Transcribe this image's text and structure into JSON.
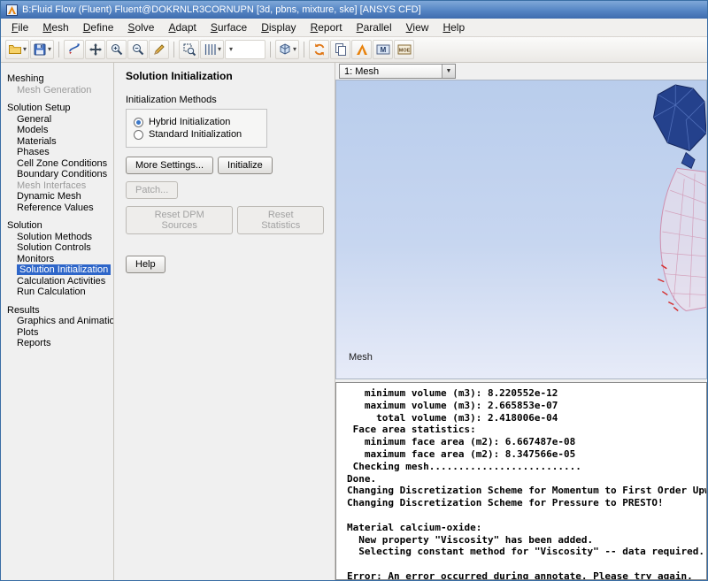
{
  "window": {
    "title": "B:Fluid Flow (Fluent) Fluent@DOKRNLR3CORNUPN [3d, pbns, mixture, ske] [ANSYS CFD]"
  },
  "menubar": {
    "items": [
      "File",
      "Mesh",
      "Define",
      "Solve",
      "Adapt",
      "Surface",
      "Display",
      "Report",
      "Parallel",
      "View",
      "Help"
    ]
  },
  "toolbar": {
    "buttons": [
      {
        "name": "open-file-button",
        "icon": "folder-icon",
        "dropdown": true
      },
      {
        "name": "save-button",
        "icon": "floppy-icon",
        "dropdown": true
      },
      {
        "separator": true
      },
      {
        "name": "rotate-view-button",
        "icon": "rotate-icon"
      },
      {
        "name": "pan-button",
        "icon": "pan-icon"
      },
      {
        "name": "zoom-in-button",
        "icon": "zoom-in-icon"
      },
      {
        "name": "zoom-out-button",
        "icon": "zoom-out-icon"
      },
      {
        "name": "probe-button",
        "icon": "pencil-icon"
      },
      {
        "separator": true
      },
      {
        "name": "fit-to-window-button",
        "icon": "zoom-fit-icon"
      },
      {
        "name": "wireframe-display-button",
        "icon": "grid-icon",
        "dropdown": true
      },
      {
        "name": "surface-combobox",
        "icon": "combo-icon",
        "dropdown": true,
        "combo": true
      },
      {
        "separator": true
      },
      {
        "name": "orientation-cube-button",
        "icon": "cube-icon",
        "dropdown": true
      },
      {
        "separator": true
      },
      {
        "name": "refresh-workbench-button",
        "icon": "refresh-icon"
      },
      {
        "name": "copy-screenshot-button",
        "icon": "copy-icon"
      },
      {
        "name": "ansys-workbench-button",
        "icon": "ansys-a-icon"
      },
      {
        "name": "model-badge-button",
        "icon": "badge-m-icon"
      },
      {
        "name": "options-badge-button",
        "icon": "badge-moe-icon"
      }
    ]
  },
  "tree": {
    "sections": [
      {
        "label": "Meshing",
        "items": [
          {
            "label": "Mesh Generation",
            "disabled": true
          }
        ]
      },
      {
        "label": "Solution Setup",
        "items": [
          {
            "label": "General"
          },
          {
            "label": "Models"
          },
          {
            "label": "Materials"
          },
          {
            "label": "Phases"
          },
          {
            "label": "Cell Zone Conditions"
          },
          {
            "label": "Boundary Conditions"
          },
          {
            "label": "Mesh Interfaces",
            "disabled": true
          },
          {
            "label": "Dynamic Mesh"
          },
          {
            "label": "Reference Values"
          }
        ]
      },
      {
        "label": "Solution",
        "items": [
          {
            "label": "Solution Methods"
          },
          {
            "label": "Solution Controls"
          },
          {
            "label": "Monitors"
          },
          {
            "label": "Solution Initialization",
            "selected": true
          },
          {
            "label": "Calculation Activities"
          },
          {
            "label": "Run Calculation"
          }
        ]
      },
      {
        "label": "Results",
        "items": [
          {
            "label": "Graphics and Animations"
          },
          {
            "label": "Plots"
          },
          {
            "label": "Reports"
          }
        ]
      }
    ]
  },
  "task_panel": {
    "title": "Solution Initialization",
    "group_label": "Initialization Methods",
    "radios": [
      {
        "label": "Hybrid Initialization",
        "selected": true
      },
      {
        "label": "Standard Initialization",
        "selected": false
      }
    ],
    "more_settings_label": "More Settings...",
    "initialize_label": "Initialize",
    "patch_label": "Patch...",
    "reset_dpm_label": "Reset DPM Sources",
    "reset_stats_label": "Reset Statistics",
    "help_label": "Help"
  },
  "graphics": {
    "view_selector_value": "1: Mesh",
    "corner_label": "Mesh"
  },
  "console": {
    "lines": [
      "   minimum volume (m3): 8.220552e-12",
      "   maximum volume (m3): 2.665853e-07",
      "     total volume (m3): 2.418006e-04",
      " Face area statistics:",
      "   minimum face area (m2): 6.667487e-08",
      "   maximum face area (m2): 8.347566e-05",
      " Checking mesh..........................",
      "Done.",
      "Changing Discretization Scheme for Momentum to First Order Upw",
      "Changing Discretization Scheme for Pressure to PRESTO!",
      "",
      "Material calcium-oxide:",
      "  New property \"Viscosity\" has been added.",
      "  Selecting constant method for \"Viscosity\" -- data required.",
      "",
      "Error: An error occurred during annotate. Please try again."
    ]
  }
}
